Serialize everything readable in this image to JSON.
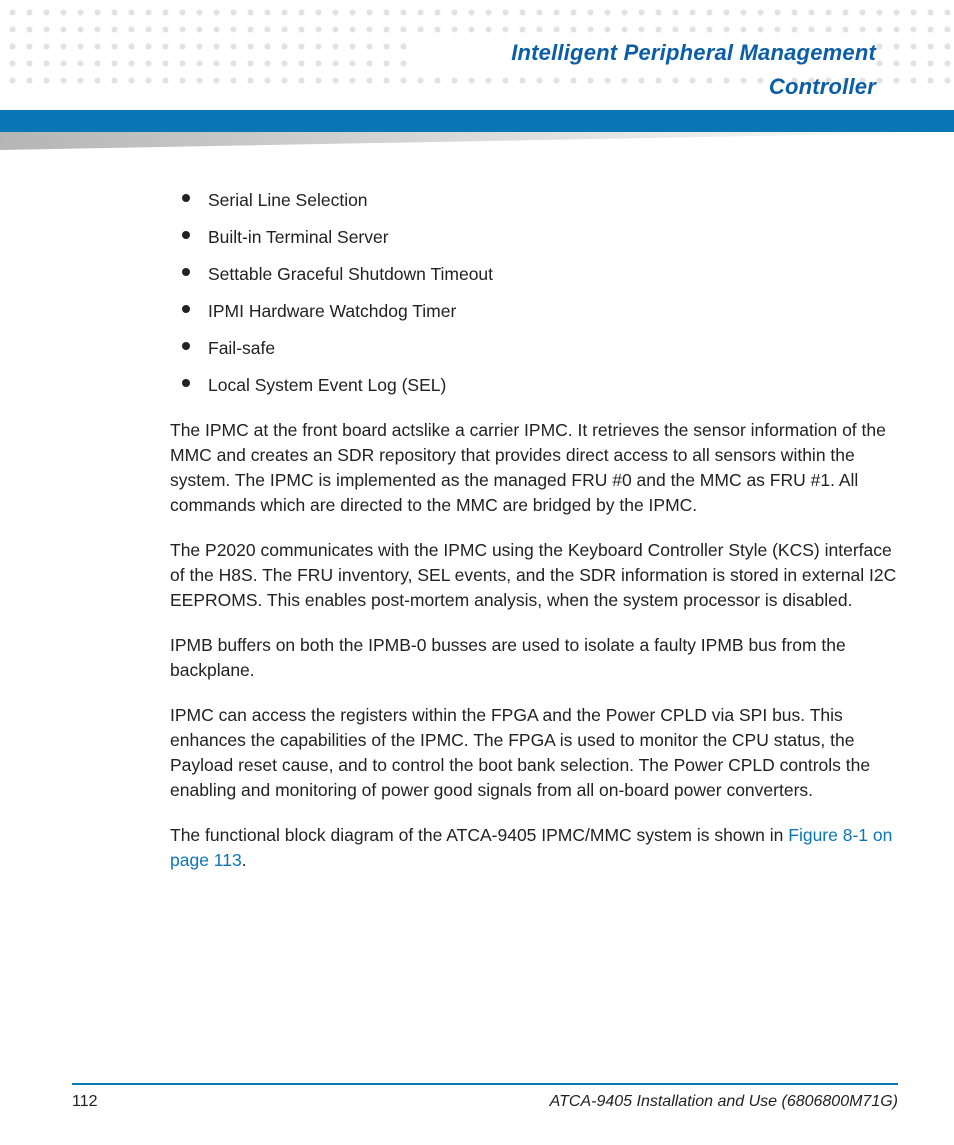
{
  "header": {
    "chapter_title": "Intelligent Peripheral Management Controller"
  },
  "bullets": [
    "Serial Line Selection",
    "Built-in Terminal Server",
    "Settable Graceful Shutdown Timeout",
    "IPMI Hardware Watchdog Timer",
    "Fail-safe",
    "Local System Event Log (SEL)"
  ],
  "paragraphs": {
    "p1": "The IPMC at the front board actslike a carrier IPMC. It retrieves the sensor information of the MMC and creates an SDR repository that provides direct access to all sensors within the system. The IPMC is implemented as the managed FRU #0 and the MMC as FRU #1. All commands which are directed to the MMC are bridged by the IPMC.",
    "p2": "The P2020 communicates with the IPMC using the Keyboard Controller Style (KCS) interface of the H8S. The FRU inventory, SEL events, and the SDR information is stored in external I2C EEPROMS. This enables post-mortem analysis, when the system processor is disabled.",
    "p3": "IPMB buffers on both the IPMB-0 busses are used to isolate a faulty IPMB bus from the backplane.",
    "p4": "IPMC can access the registers within the FPGA and the Power CPLD via SPI bus. This enhances the capabilities of the IPMC. The FPGA is used to monitor the CPU status, the Payload reset cause, and to control the boot bank selection. The Power CPLD controls the enabling and monitoring of power good signals from all on-board power converters.",
    "p5_pre": "The functional block diagram of the ATCA-9405 IPMC/MMC system is shown in ",
    "p5_link": "Figure 8-1 on page 113",
    "p5_post": "."
  },
  "footer": {
    "page": "112",
    "doc": "ATCA-9405 Installation and Use (6806800M71G)"
  }
}
